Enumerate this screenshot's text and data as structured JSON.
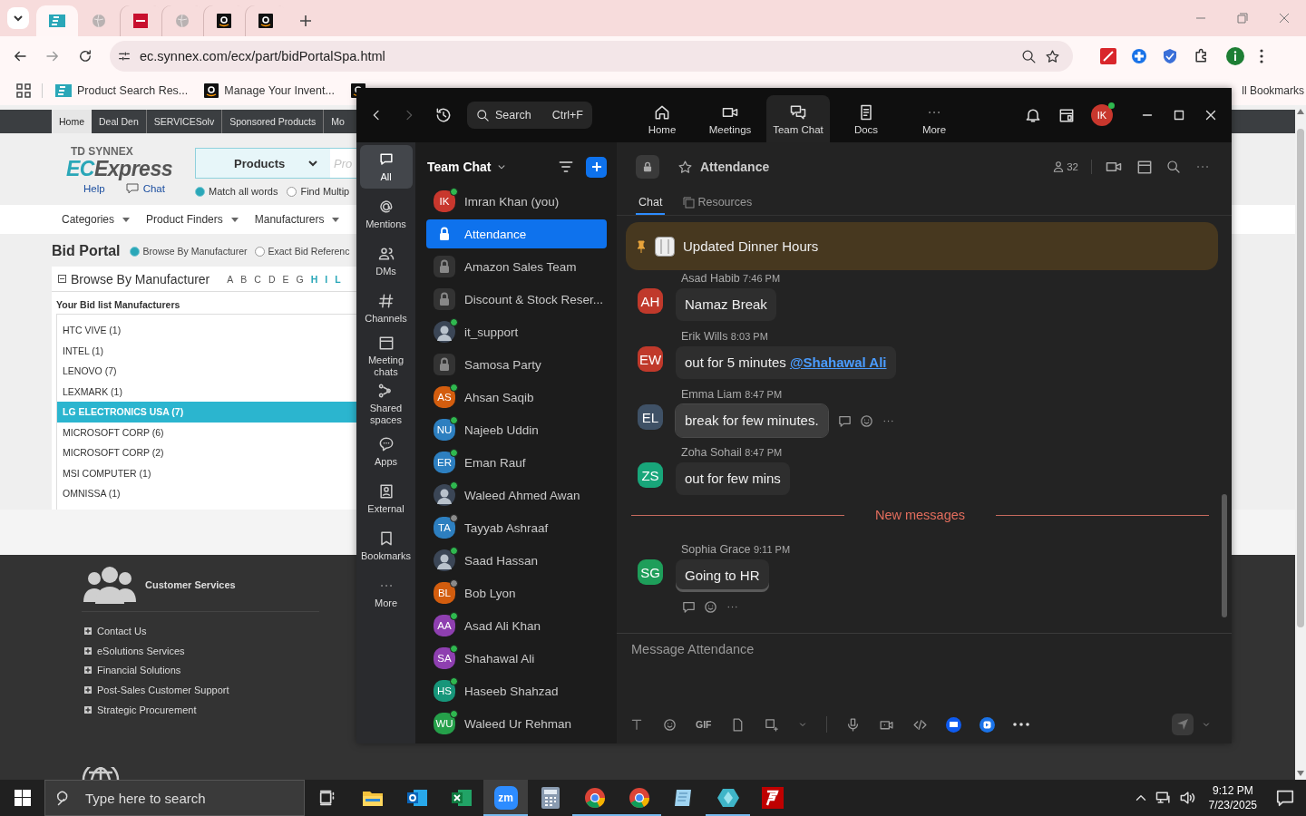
{
  "browser": {
    "tabs": [
      {
        "kind": "ec",
        "selected": true
      },
      {
        "kind": "globe",
        "selected": false
      },
      {
        "kind": "dwh",
        "selected": false
      },
      {
        "kind": "globe",
        "selected": false
      },
      {
        "kind": "amazon",
        "selected": false
      },
      {
        "kind": "amazon",
        "selected": false
      }
    ],
    "address": "ec.synnex.com/ecx/part/bidPortalSpa.html",
    "bookmarks": [
      {
        "kind": "ec",
        "label": "Product Search Res..."
      },
      {
        "kind": "amazon",
        "label": "Manage Your Invent..."
      },
      {
        "kind": "amazon"
      }
    ],
    "all_bookmarks": "ll Bookmarks"
  },
  "page": {
    "nav": [
      {
        "label": "Home",
        "selected": true
      },
      {
        "label": "Deal Den",
        "selected": false
      },
      {
        "label": "SERVICESolv",
        "selected": false
      },
      {
        "label": "Sponsored Products",
        "selected": false
      },
      {
        "label": "Mo",
        "selected": false
      }
    ],
    "logo": {
      "company": "TD SYNNEX",
      "mark": "EC",
      "word": "Express"
    },
    "search": {
      "category": "Products",
      "placeholder": "Pro"
    },
    "help": "Help",
    "chat": "Chat",
    "match_options": [
      {
        "label": "Match all words",
        "selected": true
      },
      {
        "label": "Find Multip",
        "selected": false
      }
    ],
    "menu": [
      "Categories",
      "Product Finders",
      "Manufacturers"
    ],
    "title": "Bid Portal",
    "modes": [
      {
        "label": "Browse By Manufacturer",
        "selected": true
      },
      {
        "label": "Exact Bid Referenc",
        "selected": false
      }
    ],
    "panel": {
      "title": "Browse By Manufacturer",
      "letters": [
        {
          "label": "A",
          "linked": false
        },
        {
          "label": "B",
          "linked": false
        },
        {
          "label": "C",
          "linked": false
        },
        {
          "label": "D",
          "linked": false
        },
        {
          "label": "E",
          "linked": false
        },
        {
          "label": "G",
          "linked": false
        },
        {
          "label": "H",
          "linked": true
        },
        {
          "label": "I",
          "linked": true
        },
        {
          "label": "L",
          "linked": true
        }
      ],
      "list_title": "Your Bid list Manufacturers",
      "manufacturers": [
        {
          "label": "HTC VIVE (1)",
          "selected": false
        },
        {
          "label": "INTEL (1)",
          "selected": false
        },
        {
          "label": "LENOVO (7)",
          "selected": false
        },
        {
          "label": "LEXMARK (1)",
          "selected": false
        },
        {
          "label": "LG ELECTRONICS USA (7)",
          "selected": true
        },
        {
          "label": "MICROSOFT CORP (6)",
          "selected": false
        },
        {
          "label": "MICROSOFT CORP (2)",
          "selected": false
        },
        {
          "label": "MSI COMPUTER (1)",
          "selected": false
        },
        {
          "label": "OMNISSA (1)",
          "selected": false
        }
      ]
    },
    "footer": {
      "heading": "Customer Services",
      "links": [
        "Contact Us",
        "eSolutions Services",
        "Financial Solutions",
        "Post-Sales Customer Support",
        "Strategic Procurement"
      ]
    }
  },
  "zoom": {
    "search": "Search",
    "shortcut": "Ctrl+F",
    "tabs": [
      {
        "kind": "home",
        "label": "Home",
        "selected": false
      },
      {
        "kind": "meetings",
        "label": "Meetings",
        "selected": false
      },
      {
        "kind": "chat",
        "label": "Team Chat",
        "selected": true
      },
      {
        "kind": "docs",
        "label": "Docs",
        "selected": false
      },
      {
        "kind": "more",
        "label": "More",
        "selected": false
      }
    ],
    "user": {
      "initials": "IK",
      "color": "#c8372d"
    },
    "rail": [
      {
        "kind": "all",
        "label": "All",
        "selected": true
      },
      {
        "kind": "mentions",
        "label": "Mentions",
        "selected": false
      },
      {
        "kind": "dms",
        "label": "DMs",
        "selected": false
      },
      {
        "kind": "channels",
        "label": "Channels",
        "selected": false
      },
      {
        "kind": "meetings",
        "label": "Meeting chats",
        "selected": false
      },
      {
        "kind": "spaces",
        "label": "Shared spaces",
        "selected": false
      },
      {
        "kind": "apps",
        "label": "Apps",
        "selected": false
      },
      {
        "kind": "external",
        "label": "External",
        "selected": false
      },
      {
        "kind": "bookmarks",
        "label": "Bookmarks",
        "selected": false
      },
      {
        "kind": "more",
        "label": "More",
        "selected": false
      }
    ],
    "list_title": "Team Chat",
    "chats": [
      {
        "kind": "initials",
        "initials": "IK",
        "color": "#c8372d",
        "name": "Imran Khan (you)",
        "online": true,
        "selected": false
      },
      {
        "kind": "channel",
        "name": "Attendance",
        "selected": true
      },
      {
        "kind": "channel",
        "name": "Amazon Sales Team",
        "selected": false
      },
      {
        "kind": "channel",
        "name": "Discount & Stock Reser...",
        "selected": false
      },
      {
        "kind": "photo",
        "name": "it_support",
        "online": true,
        "selected": false
      },
      {
        "kind": "channel",
        "name": "Samosa Party",
        "selected": false
      },
      {
        "kind": "initials",
        "initials": "AS",
        "color": "#d35d0e",
        "name": "Ahsan Saqib",
        "online": true,
        "selected": false
      },
      {
        "kind": "initials",
        "initials": "NU",
        "color": "#2d7fc0",
        "name": "Najeeb Uddin",
        "online": true,
        "selected": false
      },
      {
        "kind": "initials",
        "initials": "ER",
        "color": "#2d7fc0",
        "name": "Eman Rauf",
        "online": true,
        "selected": false
      },
      {
        "kind": "photo",
        "name": "Waleed Ahmed Awan",
        "online": true,
        "selected": false
      },
      {
        "kind": "initials",
        "initials": "TA",
        "color": "#2d7fc0",
        "name": "Tayyab Ashraaf",
        "online": false,
        "selected": false
      },
      {
        "kind": "photo",
        "name": "Saad Hassan",
        "online": true,
        "selected": false
      },
      {
        "kind": "initials",
        "initials": "BL",
        "color": "#d35d0e",
        "name": "Bob Lyon",
        "online": false,
        "selected": false
      },
      {
        "kind": "initials",
        "initials": "AA",
        "color": "#8e3fb0",
        "name": "Asad Ali Khan",
        "online": true,
        "selected": false
      },
      {
        "kind": "initials",
        "initials": "SA",
        "color": "#8e3fb0",
        "name": "Shahawal Ali",
        "online": true,
        "selected": false
      },
      {
        "kind": "initials",
        "initials": "HS",
        "color": "#17967a",
        "name": "Haseeb Shahzad",
        "online": true,
        "selected": false
      },
      {
        "kind": "initials",
        "initials": "WU",
        "color": "#25a04a",
        "name": "Waleed Ur Rehman",
        "online": true,
        "selected": false
      }
    ],
    "channel": {
      "name": "Attendance",
      "members": "32",
      "tabs": [
        {
          "kind": "chat",
          "label": "Chat",
          "selected": true
        },
        {
          "kind": "resources",
          "label": "Resources",
          "selected": false
        }
      ]
    },
    "pinned": "Updated Dinner Hours",
    "messages": [
      {
        "kind": "message",
        "initials": "AH",
        "color": "#c0392b",
        "sender": "Asad Habib",
        "time": "7:46 PM",
        "text": "Namaz Break",
        "hovered": false,
        "reaction_bar": false
      },
      {
        "kind": "message",
        "initials": "EW",
        "color": "#c0392b",
        "sender": "Erik Wills",
        "time": "8:03 PM",
        "text": "out for 5 minutes",
        "mention": "@Shahawal Ali",
        "hovered": false,
        "reaction_bar": false
      },
      {
        "kind": "message",
        "initials": "EL",
        "color": "#3f5166",
        "sender": "Emma Liam",
        "time": "8:47 PM",
        "text": "break for few minutes.",
        "hovered": true,
        "reaction_bar": false
      },
      {
        "kind": "message",
        "initials": "ZS",
        "color": "#18a67a",
        "sender": "Zoha Sohail",
        "time": "8:47 PM",
        "text": "out for few mins",
        "hovered": false,
        "reaction_bar": false
      },
      {
        "kind": "divider",
        "label": "New messages"
      },
      {
        "kind": "message",
        "initials": "SG",
        "color": "#1e9e5a",
        "sender": "Sophia Grace",
        "time": "9:11 PM",
        "text": "Going to HR",
        "hovered": false,
        "reaction_bar": true
      }
    ],
    "composer": {
      "placeholder": "Message Attendance",
      "gif": "GIF"
    }
  },
  "taskbar": {
    "search": "Type here to search",
    "apps": [
      {
        "kind": "explorer",
        "selected": false,
        "running": false
      },
      {
        "kind": "outlook",
        "selected": false,
        "running": false
      },
      {
        "kind": "excel",
        "selected": false,
        "running": false
      },
      {
        "kind": "zoom",
        "label": "zm",
        "selected": true,
        "running": true
      },
      {
        "kind": "calculator",
        "selected": false,
        "running": false
      },
      {
        "kind": "chrome",
        "selected": false,
        "running": true
      },
      {
        "kind": "chrome",
        "selected": false,
        "running": true
      },
      {
        "kind": "notepad",
        "selected": false,
        "running": false
      },
      {
        "kind": "diamond",
        "selected": false,
        "running": true
      },
      {
        "kind": "filezilla",
        "selected": false,
        "running": false
      }
    ],
    "time": "9:12 PM",
    "date": "7/23/2025"
  }
}
